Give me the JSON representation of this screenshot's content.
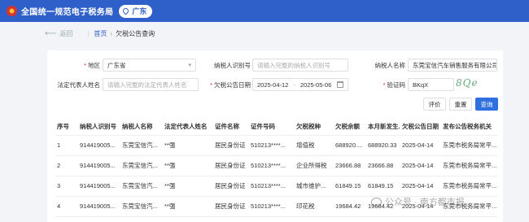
{
  "header": {
    "site_title": "全国统一规范电子税务局",
    "region": "广东"
  },
  "breadcrumb": {
    "back": "返回",
    "home": "首页",
    "current": "欠税公告查询"
  },
  "form": {
    "region_label": "地区",
    "region_value": "广东省",
    "taxpayer_id_label": "纳税人识别号",
    "taxpayer_id_placeholder": "请输入完整的纳税人识别号",
    "taxpayer_name_label": "纳税人名称",
    "taxpayer_name_value": "东莞宝信汽车销售服务有限公司",
    "legal_rep_label": "法定代表人姓名",
    "legal_rep_placeholder": "请输入完整的法定代表人姓名",
    "date_label": "欠税公告日期",
    "date_start": "2025-04-12",
    "date_sep": "-",
    "date_end": "2025-05-06",
    "captcha_label": "验证码",
    "captcha_value": "BKqX",
    "captcha_image_text": "8Qe",
    "buttons": {
      "evaluate": "评价",
      "reset": "重置",
      "query": "查询"
    }
  },
  "table": {
    "headers": [
      "序号",
      "纳税人识别号",
      "纳税人名称",
      "法定代表人姓名",
      "证件名称",
      "证件号码",
      "欠税税种",
      "欠税余额",
      "本月新发生...",
      "欠税公告日期",
      "发布公告税务机关"
    ],
    "rows": [
      [
        "1",
        "914419005...",
        "东莞宝信汽...",
        "**强",
        "居民身份证",
        "510213****...",
        "增值税",
        "688920....",
        "688920.33",
        "2025-04-14",
        "东莞市税务局常平..."
      ],
      [
        "2",
        "914419005...",
        "东莞宝信汽...",
        "**强",
        "居民身份证",
        "510213****...",
        "企业所得税",
        "23666.88",
        "23666.88",
        "2025-04-14",
        "东莞市税务局常平..."
      ],
      [
        "3",
        "914419005...",
        "东莞宝信汽...",
        "**强",
        "居民身份证",
        "510213****...",
        "城市维护...",
        "61849.15",
        "61849.15",
        "2025-04-14",
        "东莞市税务局常平..."
      ],
      [
        "4",
        "914419005...",
        "东莞宝信汽...",
        "**强",
        "居民身份证",
        "510213****...",
        "印花税",
        "19684.42",
        "19684.42",
        "2025-04-14",
        "东莞市税务局常平..."
      ]
    ]
  },
  "watermark": "公众号 · 南方都市报"
}
